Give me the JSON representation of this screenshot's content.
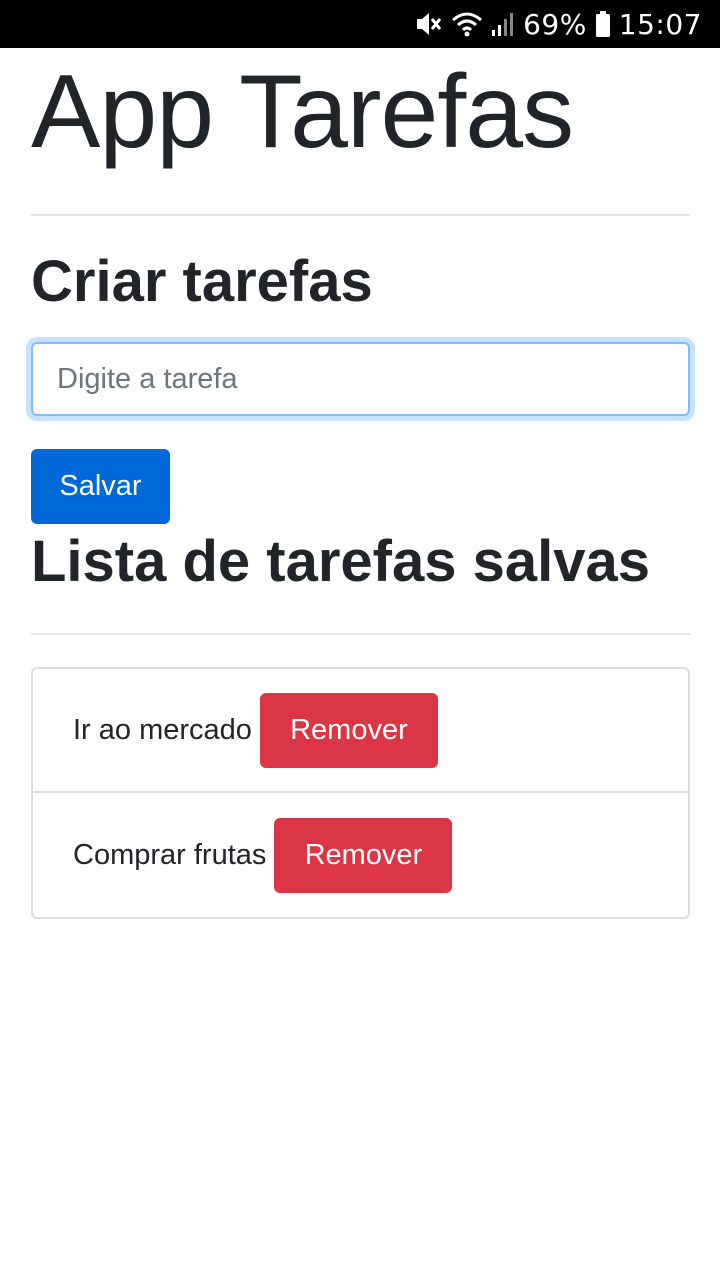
{
  "status_bar": {
    "icons": [
      "mute-icon",
      "wifi-icon",
      "signal-icon",
      "battery-icon"
    ],
    "battery": "69%",
    "time": "15:07"
  },
  "app": {
    "title": "App Tarefas"
  },
  "create_section": {
    "title": "Criar tarefas",
    "input_placeholder": "Digite a tarefa",
    "input_value": "",
    "save_label": "Salvar"
  },
  "list_section": {
    "title": "Lista de tarefas salvas",
    "items": [
      {
        "text": "Ir ao mercado",
        "remove_label": "Remover"
      },
      {
        "text": "Comprar frutas",
        "remove_label": "Remover"
      }
    ]
  },
  "colors": {
    "primary": "#0069d9",
    "danger": "#dc3545",
    "focus_border": "#80bdff",
    "text": "#212529",
    "placeholder": "#6c757d"
  }
}
